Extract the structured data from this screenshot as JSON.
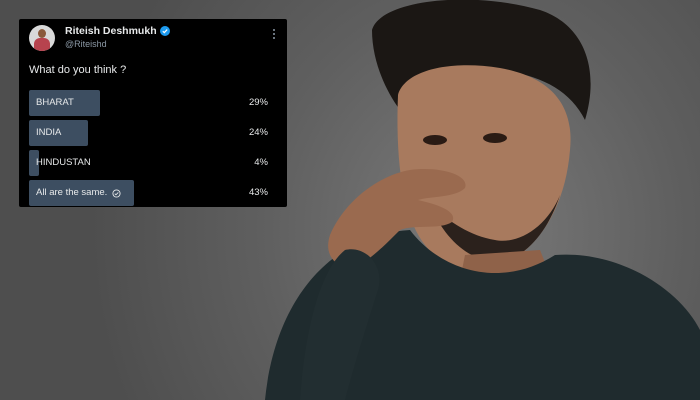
{
  "tweet": {
    "display_name": "Riteish Deshmukh",
    "handle": "@Riteishd",
    "question": "What do you think ?",
    "verified_color": "#1d9bf0",
    "bar_color": "#3d4e61",
    "more_icon": "more-vertical-icon",
    "poll": [
      {
        "label": "BHARAT",
        "percent_text": "29%",
        "percent": 29
      },
      {
        "label": "INDIA",
        "percent_text": "24%",
        "percent": 24
      },
      {
        "label": "HINDUSTAN",
        "percent_text": "4%",
        "percent": 4
      },
      {
        "label": "All are the same.",
        "percent_text": "43%",
        "percent": 43,
        "selected": true
      }
    ]
  }
}
